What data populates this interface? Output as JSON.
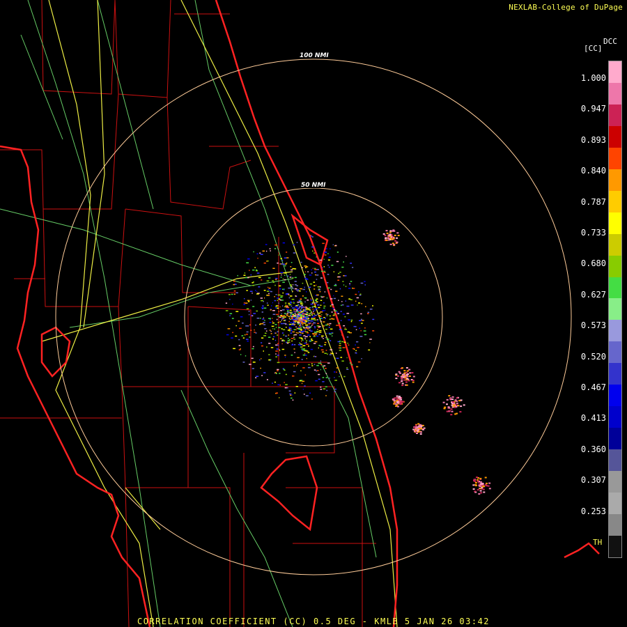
{
  "header": {
    "credit": "NEXLAB-College of DuPage"
  },
  "colorbar": {
    "unit_label": "[CC]",
    "product_label": "DCC",
    "ticks": [
      "1.000",
      "0.947",
      "0.893",
      "0.840",
      "0.787",
      "0.733",
      "0.680",
      "0.627",
      "0.573",
      "0.520",
      "0.467",
      "0.413",
      "0.360",
      "0.307",
      "0.253"
    ],
    "threshold_label": "TH",
    "colors": [
      "#ffaacc",
      "#ee77aa",
      "#cc2255",
      "#cc0000",
      "#ff4400",
      "#ff9900",
      "#ffcc00",
      "#ffff00",
      "#cccc00",
      "#88cc00",
      "#44dd44",
      "#88ee88",
      "#9999dd",
      "#6666cc",
      "#3333cc",
      "#0000ee",
      "#0000cc",
      "#000099",
      "#555599",
      "#999999",
      "#aaaaaa",
      "#888888",
      "#111111"
    ]
  },
  "map": {
    "range_rings": [
      {
        "label": "100 NMI",
        "range_nmi": 100
      },
      {
        "label": "50 NMI",
        "range_nmi": 50
      }
    ],
    "radar_site": "KMLB",
    "colors": {
      "state_lines": "#ff2222",
      "county_lines": "#cc1111",
      "highways": "#eeee44",
      "roads": "#66cc66",
      "rings": "#ffcc99"
    }
  },
  "footer": {
    "caption": "CORRELATION COEFFICIENT (CC) 0.5 DEG - KMLB 5 JAN 26 03:42"
  }
}
